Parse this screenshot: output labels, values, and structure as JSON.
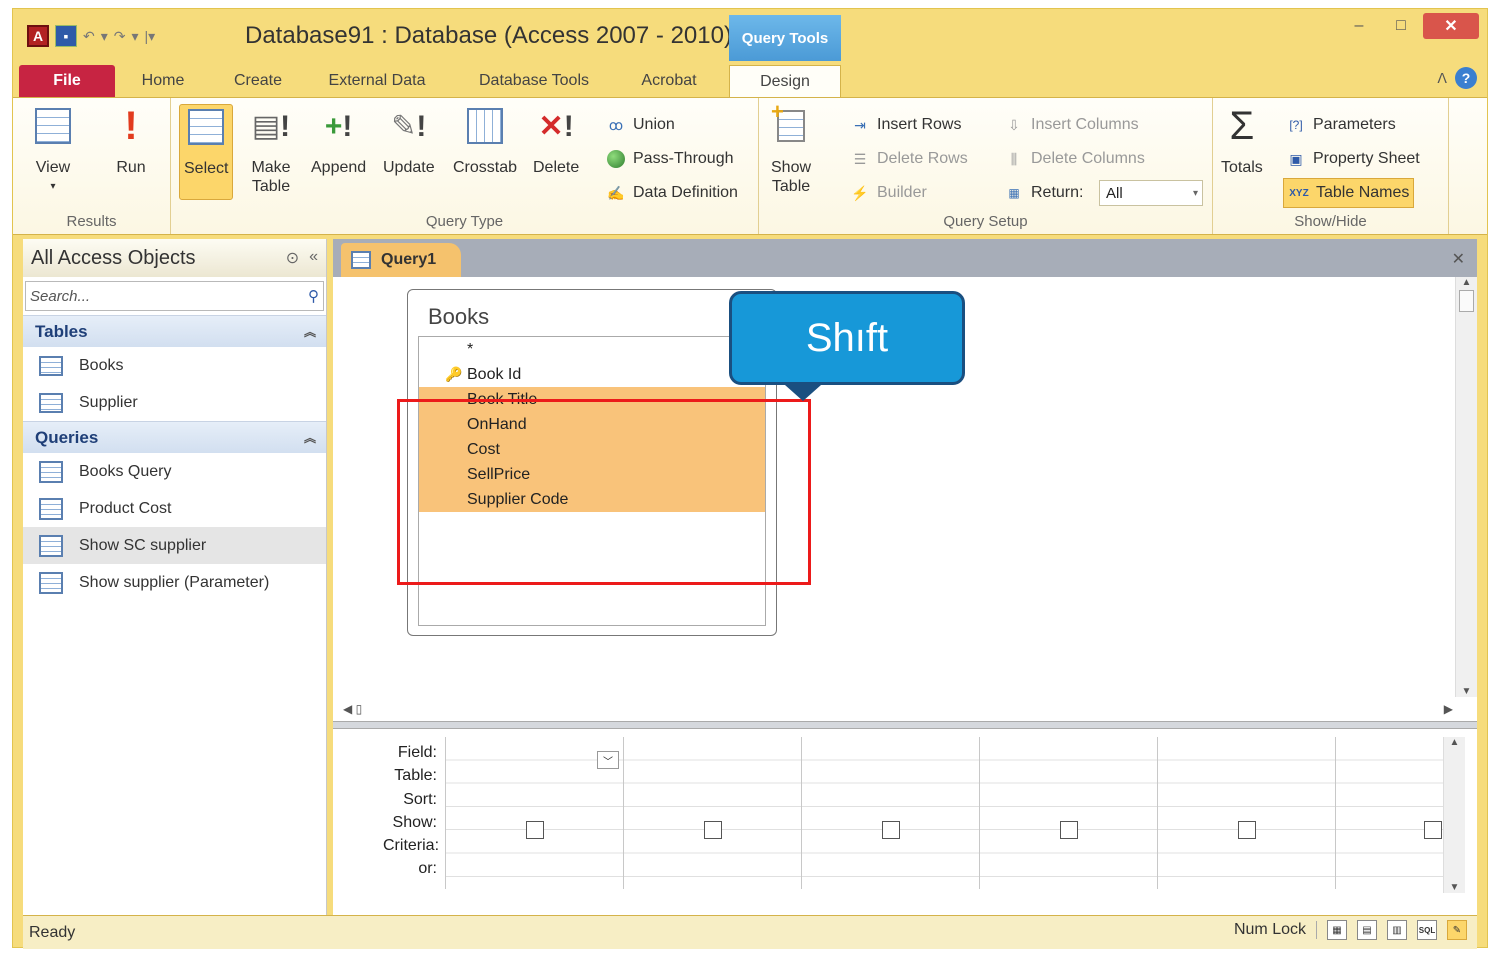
{
  "window": {
    "title": "Database91 : Database (Access 2007 - 2010)",
    "contextual_tab": "Query Tools",
    "minimize": "‒",
    "maximize": "□",
    "close": "✕"
  },
  "tabs": [
    {
      "label": "File"
    },
    {
      "label": "Home"
    },
    {
      "label": "Create"
    },
    {
      "label": "External Data"
    },
    {
      "label": "Database Tools"
    },
    {
      "label": "Acrobat"
    },
    {
      "label": "Design"
    }
  ],
  "ribbon": {
    "results": {
      "label": "Results",
      "view": "View",
      "run": "Run"
    },
    "query_type": {
      "label": "Query Type",
      "select": "Select",
      "make_table_1": "Make",
      "make_table_2": "Table",
      "append": "Append",
      "update": "Update",
      "crosstab": "Crosstab",
      "delete": "Delete",
      "union": "Union",
      "pass_through": "Pass-Through",
      "data_definition": "Data Definition"
    },
    "query_setup": {
      "label": "Query Setup",
      "show_table_1": "Show",
      "show_table_2": "Table",
      "insert_rows": "Insert Rows",
      "delete_rows": "Delete Rows",
      "builder": "Builder",
      "insert_columns": "Insert Columns",
      "delete_columns": "Delete Columns",
      "return_label": "Return:",
      "return_value": "All"
    },
    "show_hide": {
      "label": "Show/Hide",
      "totals": "Totals",
      "parameters": "Parameters",
      "property_sheet": "Property Sheet",
      "table_names": "Table Names"
    }
  },
  "nav": {
    "title": "All Access Objects",
    "search_placeholder": "Search...",
    "sections": [
      {
        "title": "Tables",
        "items": [
          "Books",
          "Supplier"
        ]
      },
      {
        "title": "Queries",
        "items": [
          "Books Query",
          "Product Cost",
          "Show SC supplier",
          "Show supplier (Parameter)"
        ]
      }
    ]
  },
  "document": {
    "tab_label": "Query1",
    "table": {
      "name": "Books",
      "fields": [
        "*",
        "Book Id",
        "Book Title",
        "OnHand",
        "Cost",
        "SellPrice",
        "Supplier Code"
      ]
    },
    "callout": "Shıft",
    "grid_rows": [
      "Field:",
      "Table:",
      "Sort:",
      "Show:",
      "Criteria:",
      "or:"
    ]
  },
  "status": {
    "left": "Ready",
    "num_lock": "Num Lock",
    "sql": "SQL"
  },
  "colors": {
    "accent": "#f6dc7c",
    "file_tab": "#c72442",
    "selection": "#f9c37a",
    "callout": "#1798d8",
    "highlight_box": "#ec1a1a"
  }
}
